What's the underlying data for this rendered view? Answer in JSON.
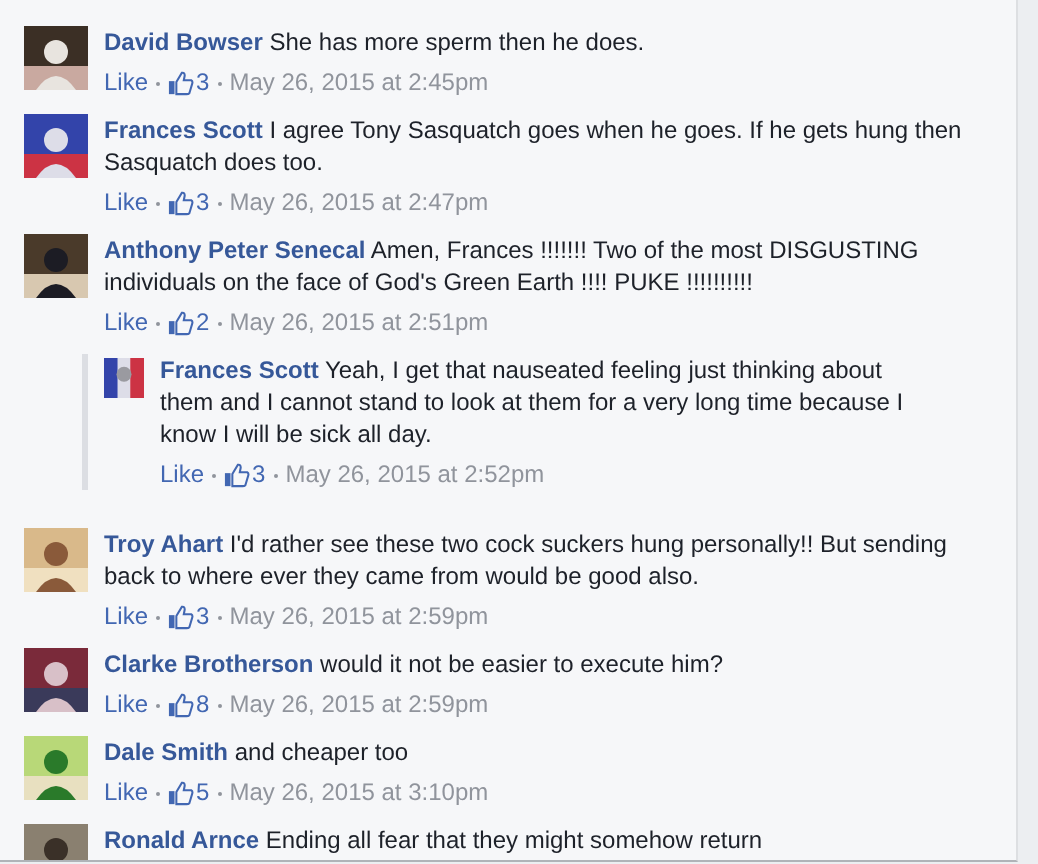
{
  "comments": [
    {
      "author": "David Bowser",
      "text": "She has more sperm then he does.",
      "like_label": "Like",
      "likes": "3",
      "time": "May 26, 2015 at 2:45pm"
    },
    {
      "author": "Frances Scott",
      "text": "I agree Tony Sasquatch goes when he goes. If he gets hung then Sasquatch does too.",
      "like_label": "Like",
      "likes": "3",
      "time": "May 26, 2015 at 2:47pm"
    },
    {
      "author": "Anthony Peter Senecal",
      "text": "Amen, Frances !!!!!!! Two of the most DISGUSTING individuals on the face of God's Green Earth !!!! PUKE !!!!!!!!!!",
      "like_label": "Like",
      "likes": "2",
      "time": "May 26, 2015 at 2:51pm",
      "children": [
        {
          "author": "Frances Scott",
          "text": "Yeah, I get that nauseated feeling just thinking about them and I cannot stand to look at them for a very long time because I know I will be sick all day.",
          "like_label": "Like",
          "likes": "3",
          "time": "May 26, 2015 at 2:52pm"
        }
      ]
    },
    {
      "author": "Troy Ahart",
      "text": "I'd rather see these two cock suckers hung personally!! But sending back to where ever they came from would be good also.",
      "like_label": "Like",
      "likes": "3",
      "time": "May 26, 2015 at 2:59pm"
    },
    {
      "author": "Clarke Brotherson",
      "text": "would it not be easier to execute him?",
      "like_label": "Like",
      "likes": "8",
      "time": "May 26, 2015 at 2:59pm"
    },
    {
      "author": "Dale Smith",
      "text": "and cheaper too",
      "like_label": "Like",
      "likes": "5",
      "time": "May 26, 2015 at 3:10pm"
    },
    {
      "author": "Ronald Arnce",
      "text": "Ending all fear that they might somehow return"
    }
  ]
}
